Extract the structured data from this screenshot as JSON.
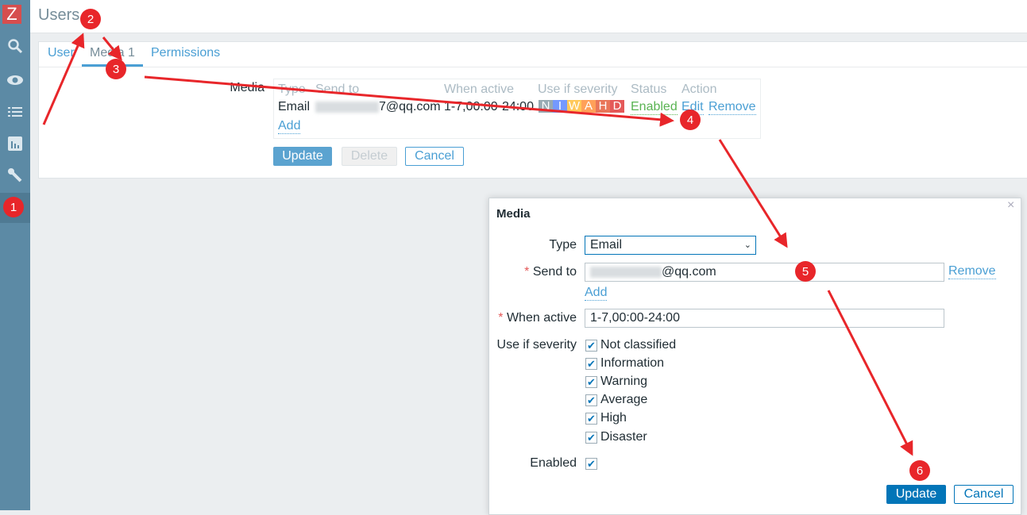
{
  "sidebar": {
    "logo": "Z",
    "items": [
      {
        "icon": "search-icon"
      },
      {
        "icon": "eye-icon"
      },
      {
        "icon": "list-icon"
      },
      {
        "icon": "chart-icon"
      },
      {
        "icon": "wrench-icon"
      },
      {
        "icon": "user-admin-icon",
        "active": true
      }
    ]
  },
  "header": {
    "title": "Users"
  },
  "tabs": [
    {
      "label": "User"
    },
    {
      "label": "Media 1",
      "active": true
    },
    {
      "label": "Permissions"
    }
  ],
  "media": {
    "label": "Media",
    "columns": [
      "Type",
      "Send to",
      "When active",
      "Use if severity",
      "Status",
      "Action"
    ],
    "row": {
      "type": "Email",
      "send_to_suffix": "7@qq.com",
      "when_active": "1-7,00:00-24:00",
      "severities": [
        "N",
        "I",
        "W",
        "A",
        "H",
        "D"
      ],
      "status": "Enabled",
      "edit": "Edit",
      "remove": "Remove"
    },
    "add": "Add"
  },
  "buttons": {
    "update": "Update",
    "delete": "Delete",
    "cancel": "Cancel"
  },
  "modal": {
    "title": "Media",
    "close": "×",
    "type_label": "Type",
    "type_value": "Email",
    "send_to_label": "Send to",
    "send_to_suffix": "@qq.com",
    "remove": "Remove",
    "add": "Add",
    "when_active_label": "When active",
    "when_active_value": "1-7,00:00-24:00",
    "severity_label": "Use if severity",
    "severities": [
      "Not classified",
      "Information",
      "Warning",
      "Average",
      "High",
      "Disaster"
    ],
    "enabled_label": "Enabled",
    "required": "*",
    "update": "Update",
    "cancel": "Cancel"
  },
  "annotations": [
    "1",
    "2",
    "3",
    "4",
    "5",
    "6"
  ],
  "colors": {
    "accent": "#4a9fd4",
    "primary_button": "#0275b8",
    "annotation": "#e8262a",
    "enabled": "#59b352"
  }
}
